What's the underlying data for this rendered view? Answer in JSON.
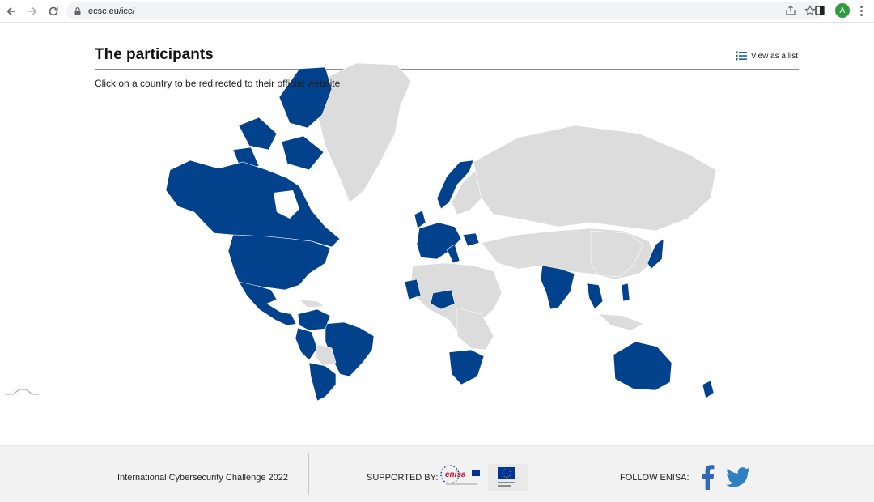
{
  "browser": {
    "url": "ecsc.eu/icc/",
    "avatar_letter": "A",
    "icons": [
      "back-icon",
      "forward-icon",
      "reload-icon",
      "lock-icon",
      "share-icon",
      "star-icon",
      "side-panel-icon",
      "menu-icon"
    ]
  },
  "page": {
    "title": "The participants",
    "view_list_label": "View as a list",
    "instructions": "Click on a country to be redirected to their official website"
  },
  "map": {
    "highlight_color": "#02428c",
    "base_color": "#dcdcdc",
    "participants": [
      "Greenland-west/Canada",
      "Canada",
      "USA",
      "Mexico",
      "Central America",
      "Brazil",
      "Peru",
      "Bolivia",
      "Chile",
      "Argentina",
      "Uruguay",
      "Paraguay",
      "Colombia",
      "Ecuador",
      "Venezuela",
      "Norway",
      "Ireland",
      "United Kingdom",
      "France",
      "Spain",
      "Portugal",
      "Germany",
      "Italy",
      "Romania",
      "Poland",
      "Morocco",
      "Nigeria",
      "Ghana",
      "South Africa",
      "Botswana",
      "Namibia",
      "India",
      "Thailand",
      "Cambodia",
      "Philippines",
      "Japan",
      "Singapore",
      "Australia",
      "New Zealand"
    ]
  },
  "footer": {
    "left_text": "International Cybersecurity Challenge 2022",
    "supported_label": "SUPPORTED BY:",
    "enisa_label": "enisa",
    "follow_label": "FOLLOW ENISA:",
    "social_icons": [
      "facebook-icon",
      "twitter-icon"
    ]
  }
}
